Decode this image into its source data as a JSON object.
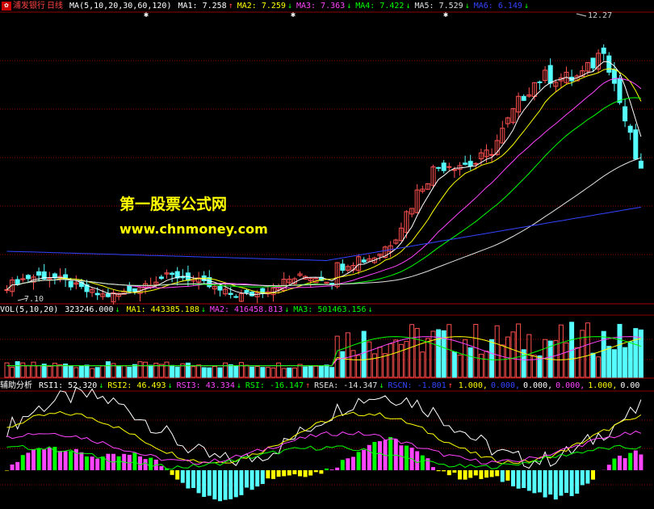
{
  "main_panel": {
    "stock_name": "浦发银行",
    "period": "日线",
    "ma_param": "MA(5,10,20,30,60,120)",
    "indicators": [
      {
        "label": "MA1:",
        "value": "7.258",
        "arrow": "↑",
        "color": "#ffffff"
      },
      {
        "label": "MA2:",
        "value": "7.259",
        "arrow": "↓",
        "color": "#ffff00"
      },
      {
        "label": "MA3:",
        "value": "7.363",
        "arrow": "↓",
        "color": "#ff44ff"
      },
      {
        "label": "MA4:",
        "value": "7.422",
        "arrow": "↓",
        "color": "#00ff00"
      },
      {
        "label": "MA5:",
        "value": "7.529",
        "arrow": "↓",
        "color": "#e0e0e0"
      },
      {
        "label": "MA6:",
        "value": "6.149",
        "arrow": "↓",
        "color": "#3344ff"
      }
    ],
    "high_label": "12.27",
    "low_label": "7.10"
  },
  "volume_panel": {
    "title": "VOL(5,10,20)",
    "volume": "323246.000",
    "volume_arrow": "↓",
    "indicators": [
      {
        "label": "MA1:",
        "value": "443385.188",
        "arrow": "↓",
        "color": "#ffff00"
      },
      {
        "label": "MA2:",
        "value": "416458.813",
        "arrow": "↓",
        "color": "#ff44ff"
      },
      {
        "label": "MA3:",
        "value": "501463.156",
        "arrow": "↓",
        "color": "#00ff00"
      }
    ]
  },
  "aux_panel": {
    "title": "辅助分析",
    "indicators": [
      {
        "label": "RSI1:",
        "value": "52.320",
        "arrow": "↓",
        "color": "#ffffff"
      },
      {
        "label": "RSI2:",
        "value": "46.493",
        "arrow": "↓",
        "color": "#ffff00"
      },
      {
        "label": "RSI3:",
        "value": "43.334",
        "arrow": "↓",
        "color": "#ff44ff"
      },
      {
        "label": "RSI:",
        "value": "-16.147",
        "arrow": "↑",
        "color": "#00ff00"
      },
      {
        "label": "RSEA:",
        "value": "-14.347",
        "arrow": "↓",
        "color": "#e0e0e0"
      },
      {
        "label": "RSCN:",
        "value": "-1.801",
        "arrow": "↑",
        "color": "#3344ff"
      }
    ],
    "extra_values": [
      {
        "value": "1.000,",
        "color": "#ffff00"
      },
      {
        "value": "0.000,",
        "color": "#3344ff"
      },
      {
        "value": "0.000,",
        "color": "#ffffff"
      },
      {
        "value": "0.000,",
        "color": "#ff44ff"
      },
      {
        "value": "1.000,",
        "color": "#ffff00"
      },
      {
        "value": "0.00",
        "color": "#ffffff"
      }
    ]
  },
  "watermark": {
    "line1": "第一股票公式网",
    "line2": "www.chnmoney.com"
  },
  "colors": {
    "up": "#ff5050",
    "down": "#55ffff",
    "grid": "#8b0000",
    "ma1": "#ffffff",
    "ma2": "#ffff00",
    "ma3": "#ff44ff",
    "ma4": "#00ff00",
    "ma5": "#e0e0e0",
    "ma6": "#3344ff"
  },
  "chart_data": {
    "type": "candlestick",
    "price_range": [
      7.1,
      12.27
    ],
    "series": [
      {
        "name": "MA1",
        "ref": "ma1"
      },
      {
        "name": "MA2",
        "ref": "ma2"
      },
      {
        "name": "MA3",
        "ref": "ma3"
      },
      {
        "name": "MA4",
        "ref": "ma4"
      },
      {
        "name": "MA5",
        "ref": "ma5"
      },
      {
        "name": "MA6",
        "ref": "ma6"
      }
    ]
  }
}
